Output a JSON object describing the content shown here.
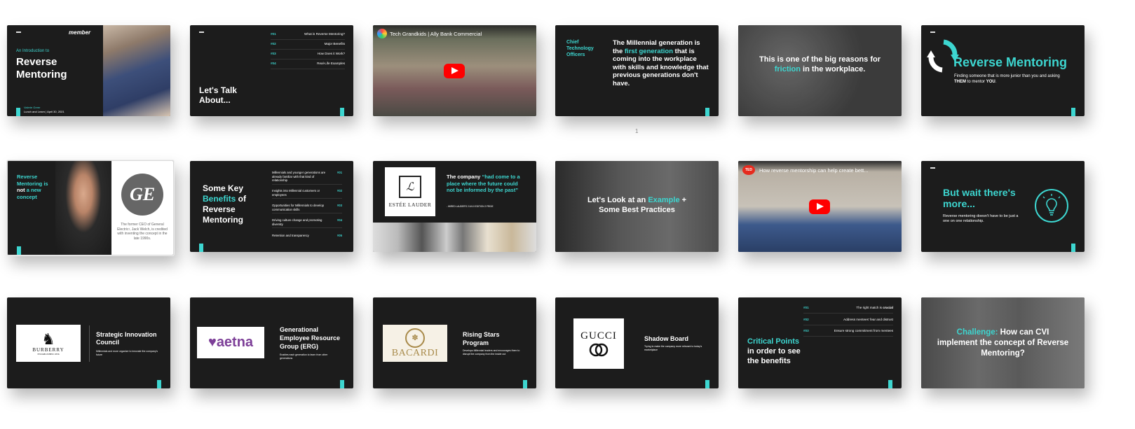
{
  "slides": {
    "s1": {
      "logo": "member",
      "subtitle": "An Introduction to",
      "title_line1": "Reverse",
      "title_line2": "Mentoring",
      "presenter": "Valerie Greer",
      "event": "Lunch and Learn | April 30, 2021"
    },
    "s2": {
      "title": "Let's Talk About...",
      "agenda": [
        {
          "num": "#01",
          "text": "What is Reverse Mentoring?"
        },
        {
          "num": "#02",
          "text": "Major Benefits"
        },
        {
          "num": "#03",
          "text": "How Does it Work?"
        },
        {
          "num": "#04",
          "text": "Real-Life Examples"
        }
      ]
    },
    "s3": {
      "video_title": "Tech Grandkids | Ally Bank Commercial"
    },
    "s4": {
      "side_label": "Chief Technology Officers",
      "text_a": "The Millennial generation is the ",
      "text_hl": "first generation",
      "text_b": " that is coming into the workplace with skills and knowledge that previous generations don't have."
    },
    "s5": {
      "text_a": "This is one of the big reasons for ",
      "text_hl": "friction",
      "text_b": " in the workplace."
    },
    "s6": {
      "title": "Reverse Mentoring",
      "desc_a": "Finding someone that is more junior than you and asking ",
      "desc_b1": "THEM",
      "desc_c": " to mentor ",
      "desc_b2": "YOU",
      "desc_d": "."
    },
    "slide_number": "1",
    "s7": {
      "t1": "Reverse Mentoring is ",
      "t2": "not",
      "t3": " a new concept",
      "ge": "GE",
      "caption": "The former CEO of General Electric¹, Jack Welch, is credited with inventing the concept in the late 1990s."
    },
    "s8": {
      "t1": "Some Key ",
      "t2": "Benefits",
      "t3": " of Reverse Mentoring",
      "items": [
        {
          "text": "Millennials and younger generations are already familiar with that kind of relationship",
          "num": "#01"
        },
        {
          "text": "Insights into Millennial customers or employees",
          "num": "#02"
        },
        {
          "text": "Opportunities for Millennials to develop communication skills",
          "num": "#03"
        },
        {
          "text": "Driving culture change and promoting diversity",
          "num": "#04"
        },
        {
          "text": "Retention and transparency",
          "num": "#05"
        }
      ]
    },
    "s9": {
      "brand": "ESTÉE LAUDER",
      "t1": "The company ",
      "t2": "“had come to a place where the future could not be informed by the past”",
      "attr": "- WIRED LAUDER'S 2.0/4.0 EDITION 2 FRIDE"
    },
    "s10": {
      "t1": "Let's Look at an ",
      "t2": "Example",
      "t3": " + Some Best Practices"
    },
    "s11": {
      "badge": "TED",
      "video_title": "How reverse mentorship can help create bett..."
    },
    "s12": {
      "title": "But wait there's more...",
      "desc": "Reverse mentoring doesn't have to be just a one on one relationship."
    },
    "s13": {
      "brand": "BURBERRY",
      "brand_sub": "ESTABLISHED 1856",
      "title": "Strategic Innovation Council",
      "desc": "Millennials and more organize to innovate the company's future"
    },
    "s14": {
      "brand": "♥aetna",
      "title": "Generational Employee Resource Group (ERG)",
      "desc": "Enables each generation to learn from other generations"
    },
    "s15": {
      "brand": "BACARDI",
      "title": "Rising Stars Program",
      "desc": "Develops Millennial leaders and encourages them to disrupt the company from the inside out"
    },
    "s16": {
      "brand": "GUCCI",
      "title": "Shadow Board",
      "desc": "Trying to make the company more relevant to today's marketplace"
    },
    "s17": {
      "t1": "Critical ",
      "t2": "Points",
      "t3": " in order to see the benefits",
      "items": [
        {
          "num": "#01",
          "text_a": "The right match is ",
          "text_b": "crucial"
        },
        {
          "num": "#02",
          "text_a": "Address mentees' fear and distrust",
          "text_b": ""
        },
        {
          "num": "#03",
          "text_a": "Ensure strong commitment from mentees",
          "text_b": ""
        }
      ]
    },
    "s18": {
      "t1": "Challenge:",
      "t2": " How can CVI implement the concept of Reverse Mentoring?"
    }
  },
  "colors": {
    "accent": "#3dd6d0",
    "slide_bg": "#1c1c1c"
  }
}
